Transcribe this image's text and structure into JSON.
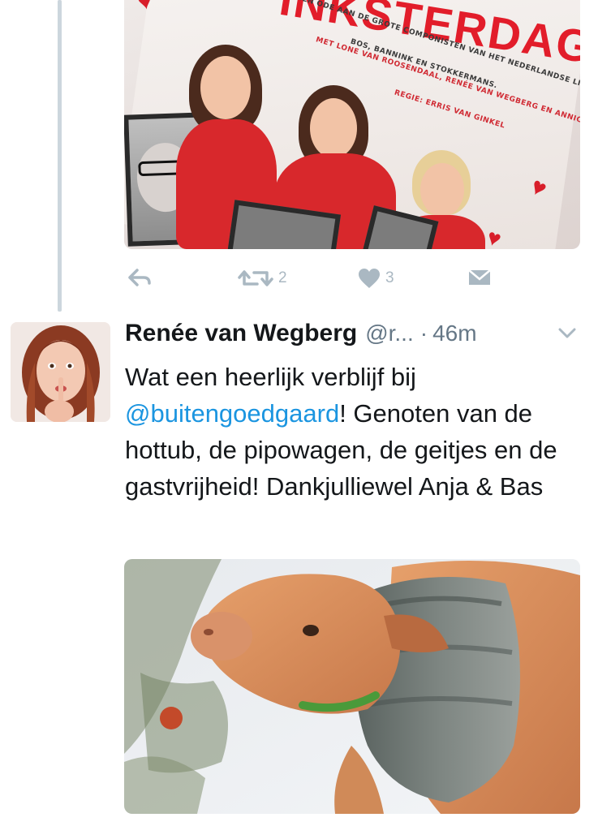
{
  "thread": {
    "previous_tweet": {
      "media": {
        "kind": "photo",
        "poster_title": "INKSTERDAG",
        "poster_lines": [
          "EEN ODE AAN DE GROTE COMPONISTEN VAN HET NEDERLANDSE LIED:",
          "BOS, BANNINK EN STOKKERMANS.",
          "MET LONE VAN ROOSENDAAL, RENÉE VAN WEGBERG EN ANNICK BOER",
          "REGIE: ERRIS VAN GINKEL"
        ]
      },
      "actions": {
        "reply": {
          "icon": "reply-icon"
        },
        "retweet": {
          "icon": "retweet-icon",
          "count": "2"
        },
        "like": {
          "icon": "heart-icon",
          "count": "3"
        },
        "dm": {
          "icon": "envelope-icon"
        }
      }
    },
    "tweet": {
      "display_name": "Renée van Wegberg",
      "handle": "@r...",
      "separator": "·",
      "time": "46m",
      "text_before": "Wat een heerlijk verblijf bij ",
      "mention": "@buitengoedgaard",
      "text_after": "! Genoten van de hottub, de pipowagen, de geitjes en de gastvrijheid! Dankjulliewel Anja & Bas",
      "media": {
        "kind": "photo",
        "subject": "goat"
      }
    }
  },
  "colors": {
    "thread_line": "#ccd6dd",
    "secondary_text": "#657786",
    "action_icon": "#aab8c2",
    "mention": "#1b95e0",
    "text": "#14171a"
  }
}
